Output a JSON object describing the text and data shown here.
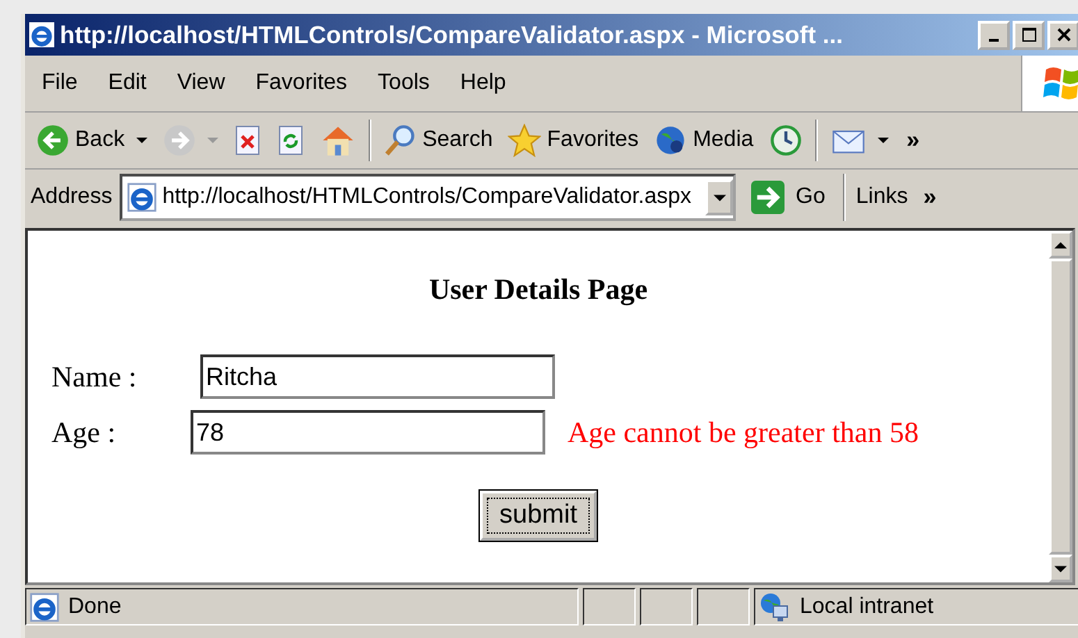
{
  "window": {
    "title": "http://localhost/HTMLControls/CompareValidator.aspx - Microsoft ..."
  },
  "menu": [
    "File",
    "Edit",
    "View",
    "Favorites",
    "Tools",
    "Help"
  ],
  "toolbar": [
    {
      "kind": "back",
      "label": "Back"
    },
    {
      "kind": "forward"
    },
    {
      "kind": "stop"
    },
    {
      "kind": "refresh"
    },
    {
      "kind": "home"
    },
    {
      "kind": "search",
      "label": "Search"
    },
    {
      "kind": "favorites",
      "label": "Favorites"
    },
    {
      "kind": "media",
      "label": "Media"
    },
    {
      "kind": "history"
    },
    {
      "kind": "mail"
    }
  ],
  "toolbar_overflow": "»",
  "address": {
    "label": "Address",
    "value": "http://localhost/HTMLControls/CompareValidator.aspx",
    "go": "Go",
    "links": "Links",
    "links_overflow": "»"
  },
  "page": {
    "heading": "User Details Page",
    "fields": [
      {
        "label": "Name :",
        "value": "Ritcha"
      },
      {
        "label": "Age :",
        "value": "78",
        "error": "Age cannot be greater than 58"
      }
    ],
    "button": "submit"
  },
  "status_bar": {
    "text": "Done",
    "zone": "Local intranet"
  }
}
